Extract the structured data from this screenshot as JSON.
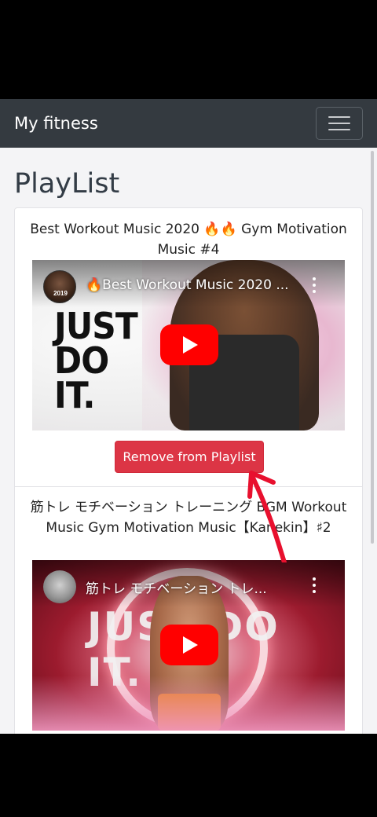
{
  "app": {
    "brand": "My fitness"
  },
  "page": {
    "title": "PlayList"
  },
  "playlist": {
    "items": [
      {
        "title": "Best Workout Music 2020 🔥🔥 Gym Motivation Music #4",
        "video_title": "🔥Best Workout Music 2020 ...",
        "thumbnail_text": "JUST DO IT.",
        "channel_badge": "2019",
        "remove_label": "Remove from Playlist"
      },
      {
        "title": "筋トレ モチベーション トレーニング BGM Workout Music Gym Motivation Music【Kanekin】♯2",
        "video_title": "筋トレ モチベーション トレ...",
        "thumbnail_text": "JUST DO IT."
      }
    ]
  },
  "colors": {
    "navbar": "#343a40",
    "danger": "#dc3545",
    "annotation_arrow": "#e8102e",
    "play_button": "#ff0000"
  },
  "icons": {
    "menu": "hamburger-icon",
    "more": "more-vertical-icon",
    "play": "play-icon",
    "annotation": "arrow-icon"
  }
}
